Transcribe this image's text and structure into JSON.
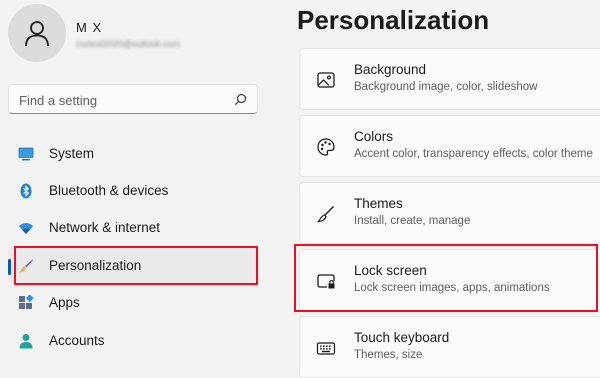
{
  "profile": {
    "name": "M X",
    "email": "mxtest2020@outlook.com"
  },
  "search": {
    "placeholder": "Find a setting"
  },
  "nav": {
    "items": [
      {
        "label": "System",
        "icon": "system-icon"
      },
      {
        "label": "Bluetooth & devices",
        "icon": "bluetooth-icon"
      },
      {
        "label": "Network & internet",
        "icon": "wifi-icon"
      },
      {
        "label": "Personalization",
        "icon": "brush-icon",
        "selected": true
      },
      {
        "label": "Apps",
        "icon": "apps-icon"
      },
      {
        "label": "Accounts",
        "icon": "person-icon"
      }
    ]
  },
  "main": {
    "title": "Personalization",
    "cards": [
      {
        "title": "Background",
        "subtitle": "Background image, color, slideshow",
        "icon": "image-icon"
      },
      {
        "title": "Colors",
        "subtitle": "Accent color, transparency effects, color theme",
        "icon": "palette-icon"
      },
      {
        "title": "Themes",
        "subtitle": "Install, create, manage",
        "icon": "brush-outline-icon"
      },
      {
        "title": "Lock screen",
        "subtitle": "Lock screen images, apps, animations",
        "icon": "lock-screen-icon"
      },
      {
        "title": "Touch keyboard",
        "subtitle": "Themes, size",
        "icon": "keyboard-icon"
      }
    ]
  },
  "colors": {
    "accent": "#005fb8",
    "highlight": "#e81123",
    "background": "#f3f3f3"
  }
}
